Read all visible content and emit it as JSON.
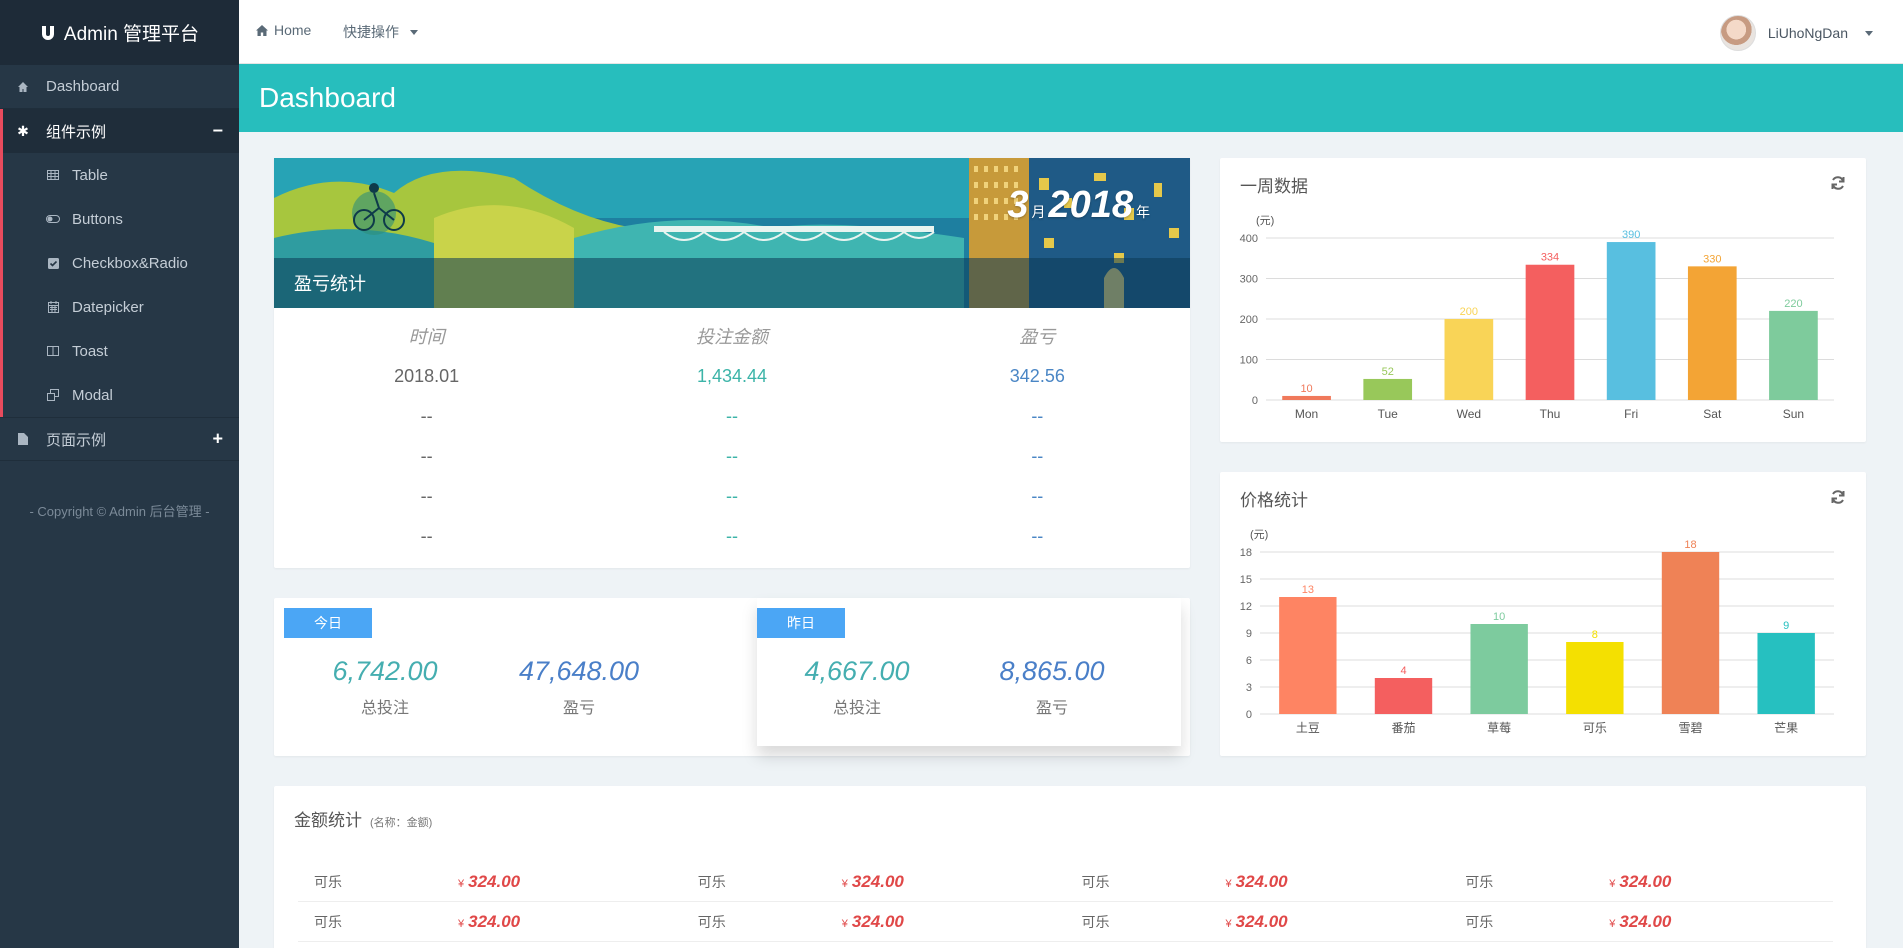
{
  "brand": {
    "title": "Admin 管理平台"
  },
  "sidebar": {
    "items": [
      {
        "label": "Dashboard",
        "icon": "home-icon"
      },
      {
        "label": "组件示例",
        "icon": "asterisk-icon",
        "toggle": "−"
      },
      {
        "label": "页面示例",
        "icon": "file-icon",
        "toggle": "+"
      }
    ],
    "sub_items": [
      {
        "label": "Table",
        "icon": "table-icon"
      },
      {
        "label": "Buttons",
        "icon": "toggle-icon"
      },
      {
        "label": "Checkbox&Radio",
        "icon": "checkbox-icon"
      },
      {
        "label": "Datepicker",
        "icon": "calendar-icon"
      },
      {
        "label": "Toast",
        "icon": "columns-icon"
      },
      {
        "label": "Modal",
        "icon": "window-restore-icon"
      }
    ],
    "copyright": "- Copyright © Admin 后台管理 -"
  },
  "topbar": {
    "home": "Home",
    "quick": "快捷操作",
    "user": "LiUhoNgDan"
  },
  "page": {
    "title": "Dashboard"
  },
  "profit": {
    "title": "盈亏统计",
    "date_month": "3",
    "date_month_unit": "月",
    "date_year": "2018",
    "date_year_unit": "年",
    "headers": [
      "时间",
      "投注金额",
      "盈亏"
    ],
    "rows": [
      [
        "2018.01",
        "1,434.44",
        "342.56"
      ],
      [
        "--",
        "--",
        "--"
      ],
      [
        "--",
        "--",
        "--"
      ],
      [
        "--",
        "--",
        "--"
      ],
      [
        "--",
        "--",
        "--"
      ]
    ]
  },
  "today": {
    "tag": "今日",
    "total_bet": "6,742.00",
    "total_bet_label": "总投注",
    "profit": "47,648.00",
    "profit_label": "盈亏"
  },
  "yesterday": {
    "tag": "昨日",
    "total_bet": "4,667.00",
    "total_bet_label": "总投注",
    "profit": "8,865.00",
    "profit_label": "盈亏"
  },
  "chart_data": [
    {
      "type": "bar",
      "title": "一周数据",
      "ylabel": "(元)",
      "categories": [
        "Mon",
        "Tue",
        "Wed",
        "Thu",
        "Fri",
        "Sat",
        "Sun"
      ],
      "values": [
        10,
        52,
        200,
        334,
        390,
        330,
        220
      ],
      "colors": [
        "#f0795b",
        "#98c85a",
        "#f9d457",
        "#f45f5f",
        "#58bfe0",
        "#f3a435",
        "#7ecb9c"
      ],
      "ylim": [
        0,
        400
      ],
      "yticks": [
        0,
        100,
        200,
        300,
        400
      ],
      "grid": true
    },
    {
      "type": "bar",
      "title": "价格统计",
      "ylabel": "(元)",
      "categories": [
        "土豆",
        "番茄",
        "草莓",
        "可乐",
        "雪碧",
        "芒果"
      ],
      "values": [
        13,
        4,
        10,
        8,
        18,
        9
      ],
      "colors": [
        "#fe8463",
        "#f45f5f",
        "#7dcb9e",
        "#f4e001",
        "#ef8256",
        "#26c0c0"
      ],
      "ylim": [
        0,
        18
      ],
      "yticks": [
        0,
        3,
        6,
        9,
        12,
        15,
        18
      ],
      "grid": true
    }
  ],
  "amount": {
    "title": "金额统计",
    "subtitle": "(名称：金额)",
    "currency": "¥",
    "rows": [
      [
        {
          "name": "可乐",
          "value": "324.00"
        },
        {
          "name": "可乐",
          "value": "324.00"
        },
        {
          "name": "可乐",
          "value": "324.00"
        },
        {
          "name": "可乐",
          "value": "324.00"
        }
      ],
      [
        {
          "name": "可乐",
          "value": "324.00"
        },
        {
          "name": "可乐",
          "value": "324.00"
        },
        {
          "name": "可乐",
          "value": "324.00"
        },
        {
          "name": "可乐",
          "value": "324.00"
        }
      ]
    ]
  }
}
